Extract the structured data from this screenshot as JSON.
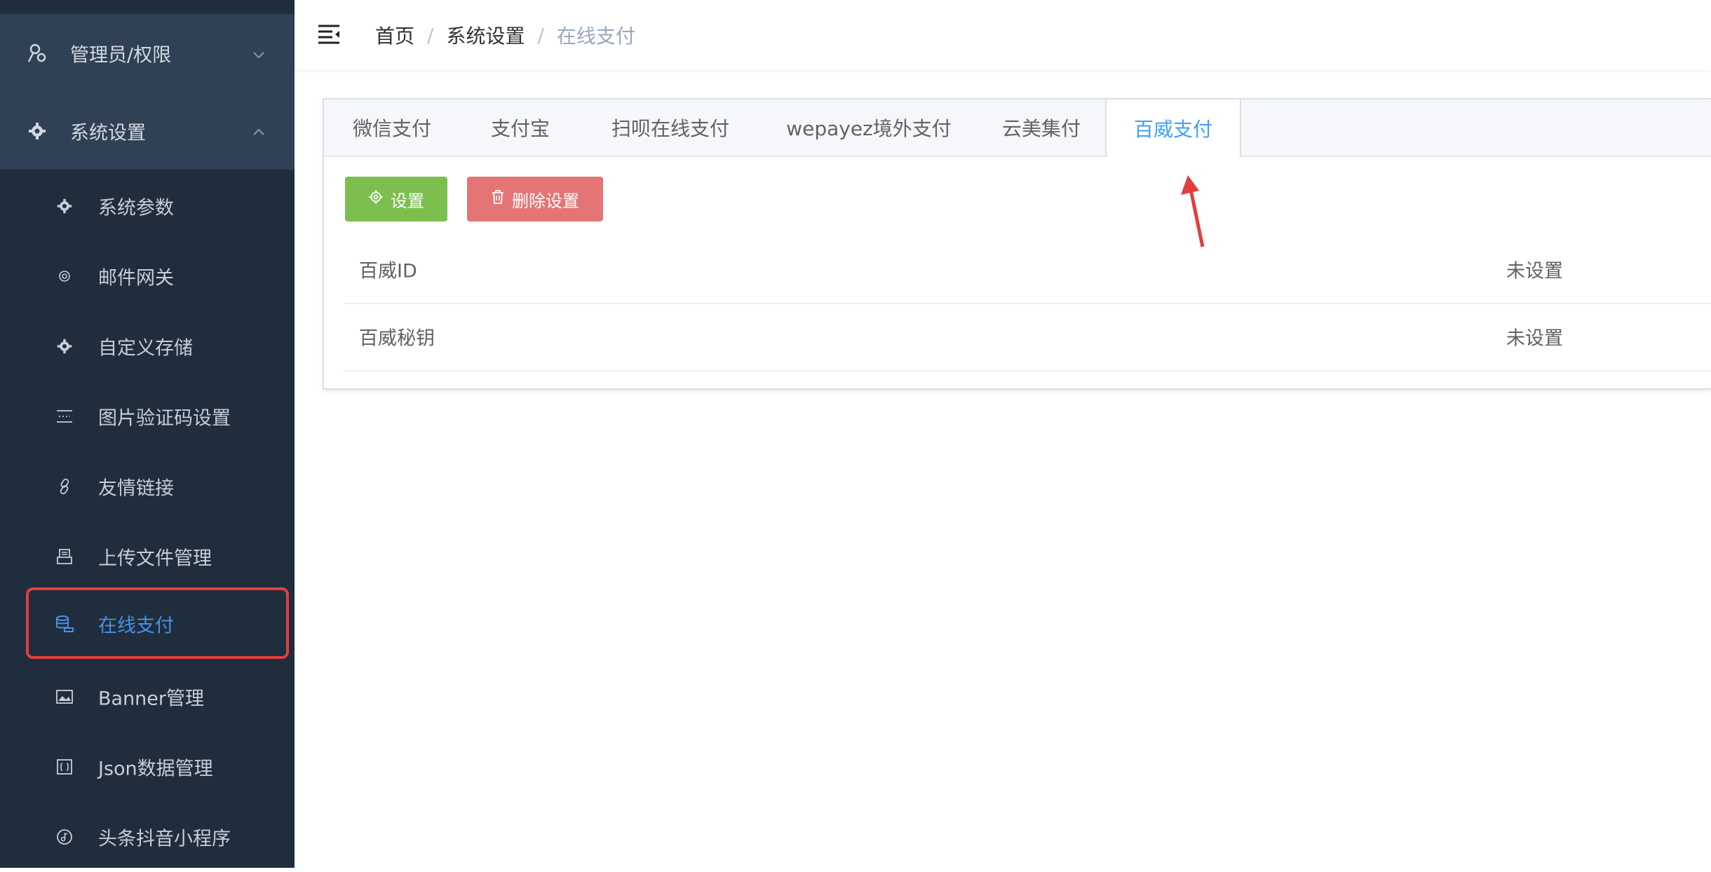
{
  "sidebar": {
    "groups": [
      {
        "label": "管理员/权限",
        "icon": "user-key-icon",
        "chevron": "chevron-down-icon"
      },
      {
        "label": "系统设置",
        "icon": "gear-icon",
        "chevron": "chevron-up-icon"
      }
    ],
    "items": [
      {
        "label": "系统参数",
        "icon": "gear-icon"
      },
      {
        "label": "邮件网关",
        "icon": "at-icon"
      },
      {
        "label": "自定义存储",
        "icon": "gear-icon"
      },
      {
        "label": "图片验证码设置",
        "icon": "captcha-icon"
      },
      {
        "label": "友情链接",
        "icon": "link-icon"
      },
      {
        "label": "上传文件管理",
        "icon": "file-stack-icon"
      },
      {
        "label": "在线支付",
        "icon": "coins-icon",
        "active": true
      },
      {
        "label": "Banner管理",
        "icon": "image-icon"
      },
      {
        "label": "Json数据管理",
        "icon": "json-icon"
      },
      {
        "label": "头条抖音小程序",
        "icon": "music-icon"
      }
    ]
  },
  "header": {
    "breadcrumb": [
      "首页",
      "系统设置",
      "在线支付"
    ],
    "separator": "/"
  },
  "tabs": [
    "微信支付",
    "支付宝",
    "扫呗在线支付",
    "wepayez境外支付",
    "云美集付",
    "百威支付"
  ],
  "active_tab": "百威支付",
  "buttons": {
    "settings": "设置",
    "delete": "删除设置"
  },
  "rows": [
    {
      "key": "百威ID",
      "value": "未设置"
    },
    {
      "key": "百威秘钥",
      "value": "未设置"
    }
  ],
  "colors": {
    "sidebar_bg": "#1f2d3d",
    "sidebar_group_bg": "#304156",
    "accent": "#409eff",
    "settings_btn": "#7cbf4e",
    "delete_btn": "#e57575",
    "annotation_red": "#e23e3e"
  }
}
